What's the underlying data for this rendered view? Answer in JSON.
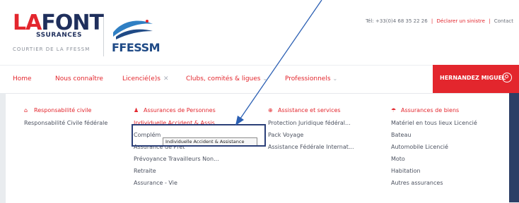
{
  "header": {
    "logo_main_a": "LA",
    "logo_main_b": "FONT",
    "logo_sub": "SSURANCES",
    "logo_courtier": "COURTIER DE LA FFESSM",
    "logo_partner": "FFESSM",
    "phone": "Tél: +33(0)4 68 35 22 26",
    "declare_link": "Déclarer un sinistre",
    "contact_link": "Contact"
  },
  "nav": {
    "home": "Home",
    "about": "Nous connaître",
    "licencies": "Licencié(e)s",
    "clubs": "Clubs, comités & ligues",
    "pros": "Professionnels",
    "user_name": "HERNANDEZ MIGUEL"
  },
  "mega": {
    "columns": [
      {
        "title": "Responsabilité civile",
        "icon": "bank-icon",
        "items": [
          "Responsabilité Civile fédérale"
        ]
      },
      {
        "title": "Assurances de Personnes",
        "icon": "person-icon",
        "items": [
          "Individuelle Accident & Assis...",
          "Complém",
          "Assurance de Prêt",
          "Prévoyance Travailleurs Non...",
          "Retraite",
          "Assurance - Vie"
        ]
      },
      {
        "title": "Assistance et services",
        "icon": "lifebuoy-icon",
        "items": [
          "Protection Juridique fédéral...",
          "Pack Voyage",
          "Assistance Fédérale Internat..."
        ]
      },
      {
        "title": "Assurances de biens",
        "icon": "umbrella-icon",
        "items": [
          "Matériel en tous lieux Licencié",
          "Bateau",
          "Automobile Licencié",
          "Moto",
          "Habitation",
          "Autres assurances"
        ]
      }
    ],
    "tooltip": "Individuelle Accident & Assistance"
  },
  "colors": {
    "accent": "#e3262d",
    "navy": "#1f2f5c",
    "annotation": "#2b3f78"
  }
}
